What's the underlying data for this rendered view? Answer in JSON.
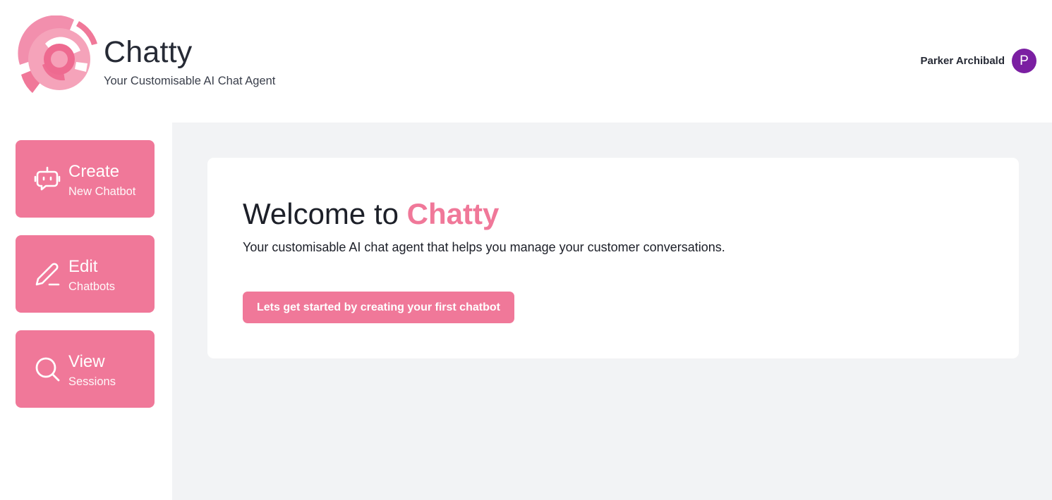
{
  "brand": {
    "title": "Chatty",
    "subtitle": "Your Customisable AI Chat Agent",
    "logo_icon": "chatty-logo-icon",
    "accent_color": "#f07899"
  },
  "user": {
    "name": "Parker Archibald",
    "initial": "P",
    "avatar_color": "#7b1fa2"
  },
  "sidebar": {
    "items": [
      {
        "title": "Create",
        "subtitle": "New Chatbot",
        "icon": "robot-icon"
      },
      {
        "title": "Edit",
        "subtitle": "Chatbots",
        "icon": "pencil-icon"
      },
      {
        "title": "View",
        "subtitle": "Sessions",
        "icon": "search-icon"
      }
    ]
  },
  "welcome": {
    "title_prefix": "Welcome to ",
    "title_accent": "Chatty",
    "description": "Your customisable AI chat agent that helps you manage your customer conversations.",
    "cta_label": "Lets get started by creating your first chatbot"
  }
}
